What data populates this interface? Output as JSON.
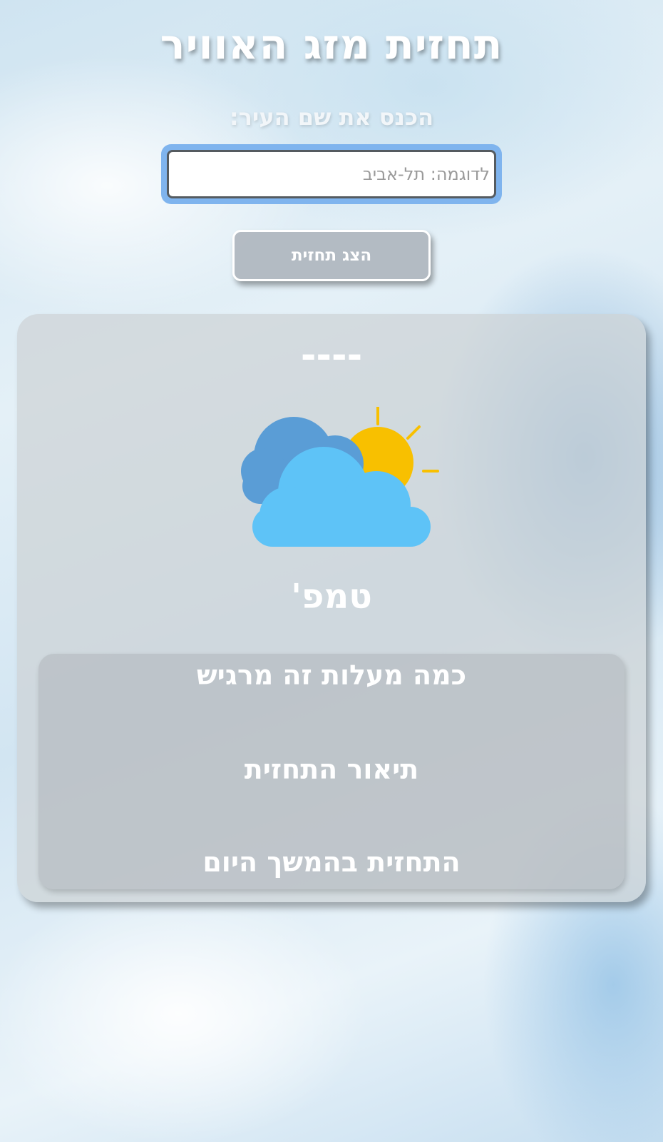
{
  "header": {
    "title": "תחזית מזג האוויר"
  },
  "search": {
    "label": "הכנס את שם העיר:",
    "placeholder": "לדוגמה: תל-אביב",
    "value": "",
    "button_label": "הצג תחזית"
  },
  "forecast": {
    "city": "----",
    "icon": "partly-cloudy-icon",
    "temperature": "טמפ'",
    "feels_like": "כמה מעלות זה מרגיש",
    "description": "תיאור התחזית",
    "later_today": "התחזית בהמשך היום"
  },
  "colors": {
    "sun": "#f8c000",
    "cloud_front": "#5ec3f7",
    "cloud_back": "#5a9dd6",
    "input_focus_ring": "#7fb4ee"
  }
}
